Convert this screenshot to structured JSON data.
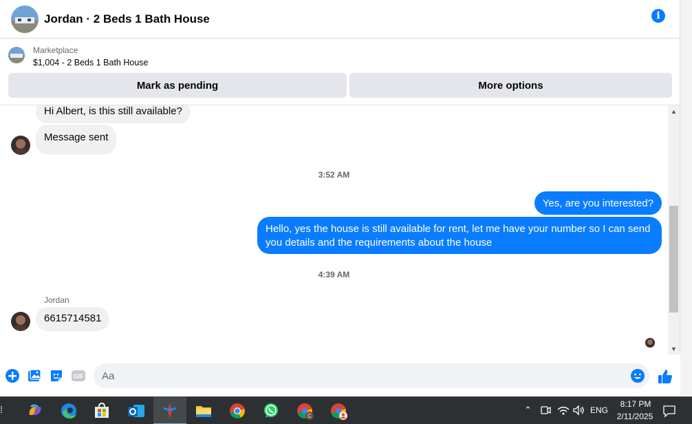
{
  "header": {
    "title": "Jordan · 2 Beds 1 Bath House",
    "info_icon": "info-icon"
  },
  "marketplace": {
    "label": "Marketplace",
    "listing": "$1,004 - 2 Beds 1 Bath House",
    "mark_pending_label": "Mark as pending",
    "more_options_label": "More options"
  },
  "messages": {
    "m1": "Hi Albert, is this still available?",
    "m2": "Message sent",
    "ts1": "3:52 AM",
    "m3": "Yes, are you interested?",
    "m4": "Hello, yes the house is still available for rent, let me have your number so I can send you details and the requirements about the house",
    "ts2": "4:39 AM",
    "sender": "Jordan",
    "m5": "6615714581"
  },
  "composer": {
    "placeholder": "Aa",
    "gif_label": "GIF",
    "icons": [
      "plus-circle-icon",
      "photo-icon",
      "sticker-icon",
      "gif-icon",
      "emoji-icon",
      "thumbs-up-icon"
    ]
  },
  "taskbar": {
    "apps": [
      "copilot-icon",
      "edge-icon",
      "store-icon",
      "outlook-icon",
      "app-icon",
      "file-explorer-icon",
      "chrome-icon",
      "whatsapp-icon",
      "chrome-profile-c-icon",
      "chrome-profile-icon"
    ],
    "language": "ENG",
    "time": "8:17 PM",
    "date": "2/11/2025"
  },
  "colors": {
    "accent": "#0a7cff",
    "incoming_bubble": "#f0f0f0",
    "taskbar": "#2c3032"
  }
}
